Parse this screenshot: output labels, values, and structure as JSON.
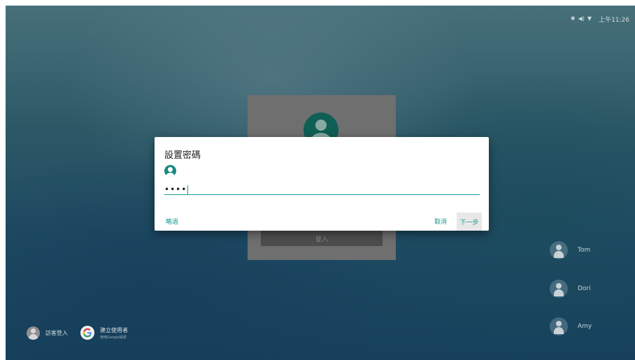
{
  "status_bar": {
    "icons": [
      "bluetooth-icon",
      "volume-icon",
      "wifi-icon"
    ],
    "bluetooth_glyph": "✱",
    "volume_glyph": "◀)",
    "wifi_glyph": "▼",
    "time": "上午11:26"
  },
  "login_card": {
    "button_label": "登入"
  },
  "dialog": {
    "title": "設置密碼",
    "password_value": "••••",
    "skip_label": "略過",
    "cancel_label": "取消",
    "next_label": "下一步",
    "accent_color": "#1a9a8e"
  },
  "users": [
    {
      "name": "Tom"
    },
    {
      "name": "Dori"
    },
    {
      "name": "Amy"
    }
  ],
  "bottom_actions": {
    "guest_label": "訪客登入",
    "create_user_label": "建立使用者",
    "create_user_sublabel": "使用Google帳號"
  }
}
